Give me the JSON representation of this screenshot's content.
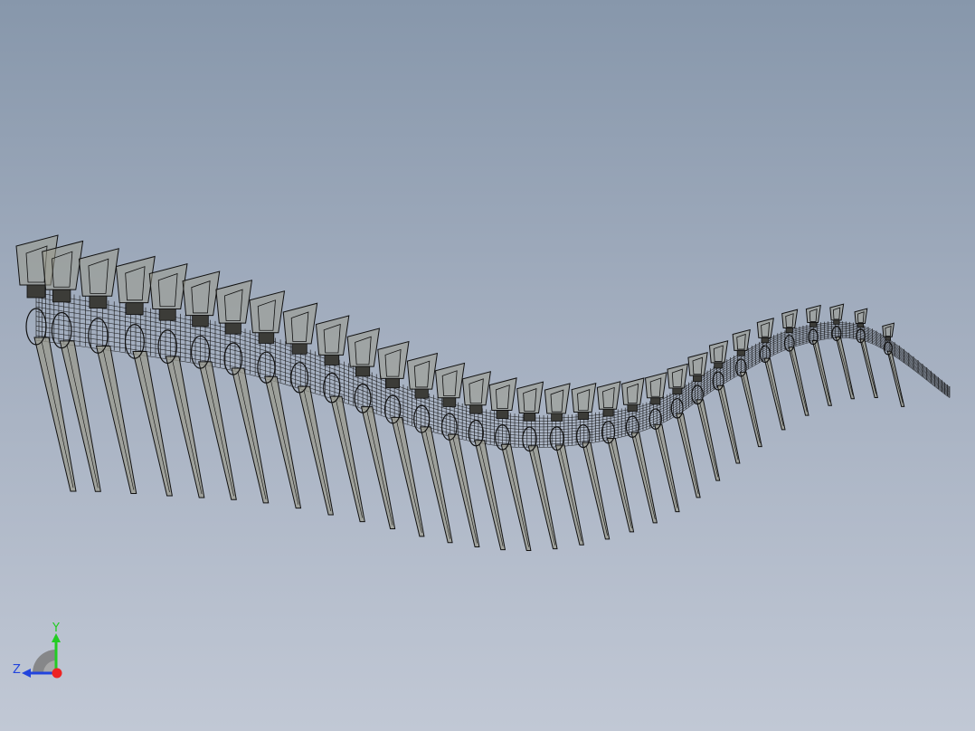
{
  "viewport": {
    "background_top": "#8797ab",
    "background_bottom": "#c1c8d5"
  },
  "model": {
    "description_icon": "spine-tail-wireframe",
    "edge_color": "#111111",
    "fill_color": "#9a9a8c",
    "vertebra_count": 32
  },
  "triad": {
    "x_label": "",
    "y_label": "Y",
    "z_label": "Z",
    "y_color": "#22cc22",
    "z_color": "#2244dd",
    "x_color": "#ee2222"
  }
}
